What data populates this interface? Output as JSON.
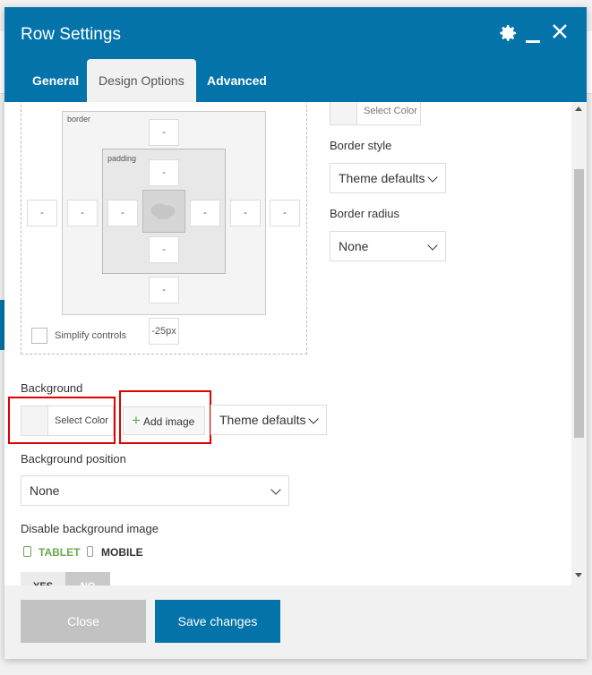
{
  "modal": {
    "title": "Row Settings",
    "header_icons": [
      "gear-icon",
      "minimize-icon",
      "close-icon"
    ],
    "tabs": [
      {
        "label": "General",
        "active": false
      },
      {
        "label": "Design Options",
        "active": true
      },
      {
        "label": "Advanced",
        "active": false
      }
    ]
  },
  "box_model": {
    "border_label": "border",
    "padding_label": "padding",
    "empty_value": "-",
    "margin_bottom_value": "-25px",
    "simplify_label": "Simplify controls"
  },
  "right_column": {
    "select_color": "Select Color",
    "border_style_label": "Border style",
    "border_style_value": "Theme defaults",
    "border_radius_label": "Border radius",
    "border_radius_value": "None"
  },
  "background": {
    "label": "Background",
    "select_color": "Select Color",
    "add_image": "Add image",
    "style_value": "Theme defaults",
    "position_label": "Background position",
    "position_value": "None",
    "disable_label": "Disable background image",
    "tablet_label": "TABLET",
    "mobile_label": "MOBILE",
    "yes_label": "YES",
    "no_label": "NO"
  },
  "footer": {
    "close_label": "Close",
    "save_label": "Save changes"
  },
  "colors": {
    "primary": "#0473aa",
    "highlight": "#e00000",
    "tablet_active": "#6aa84f"
  }
}
